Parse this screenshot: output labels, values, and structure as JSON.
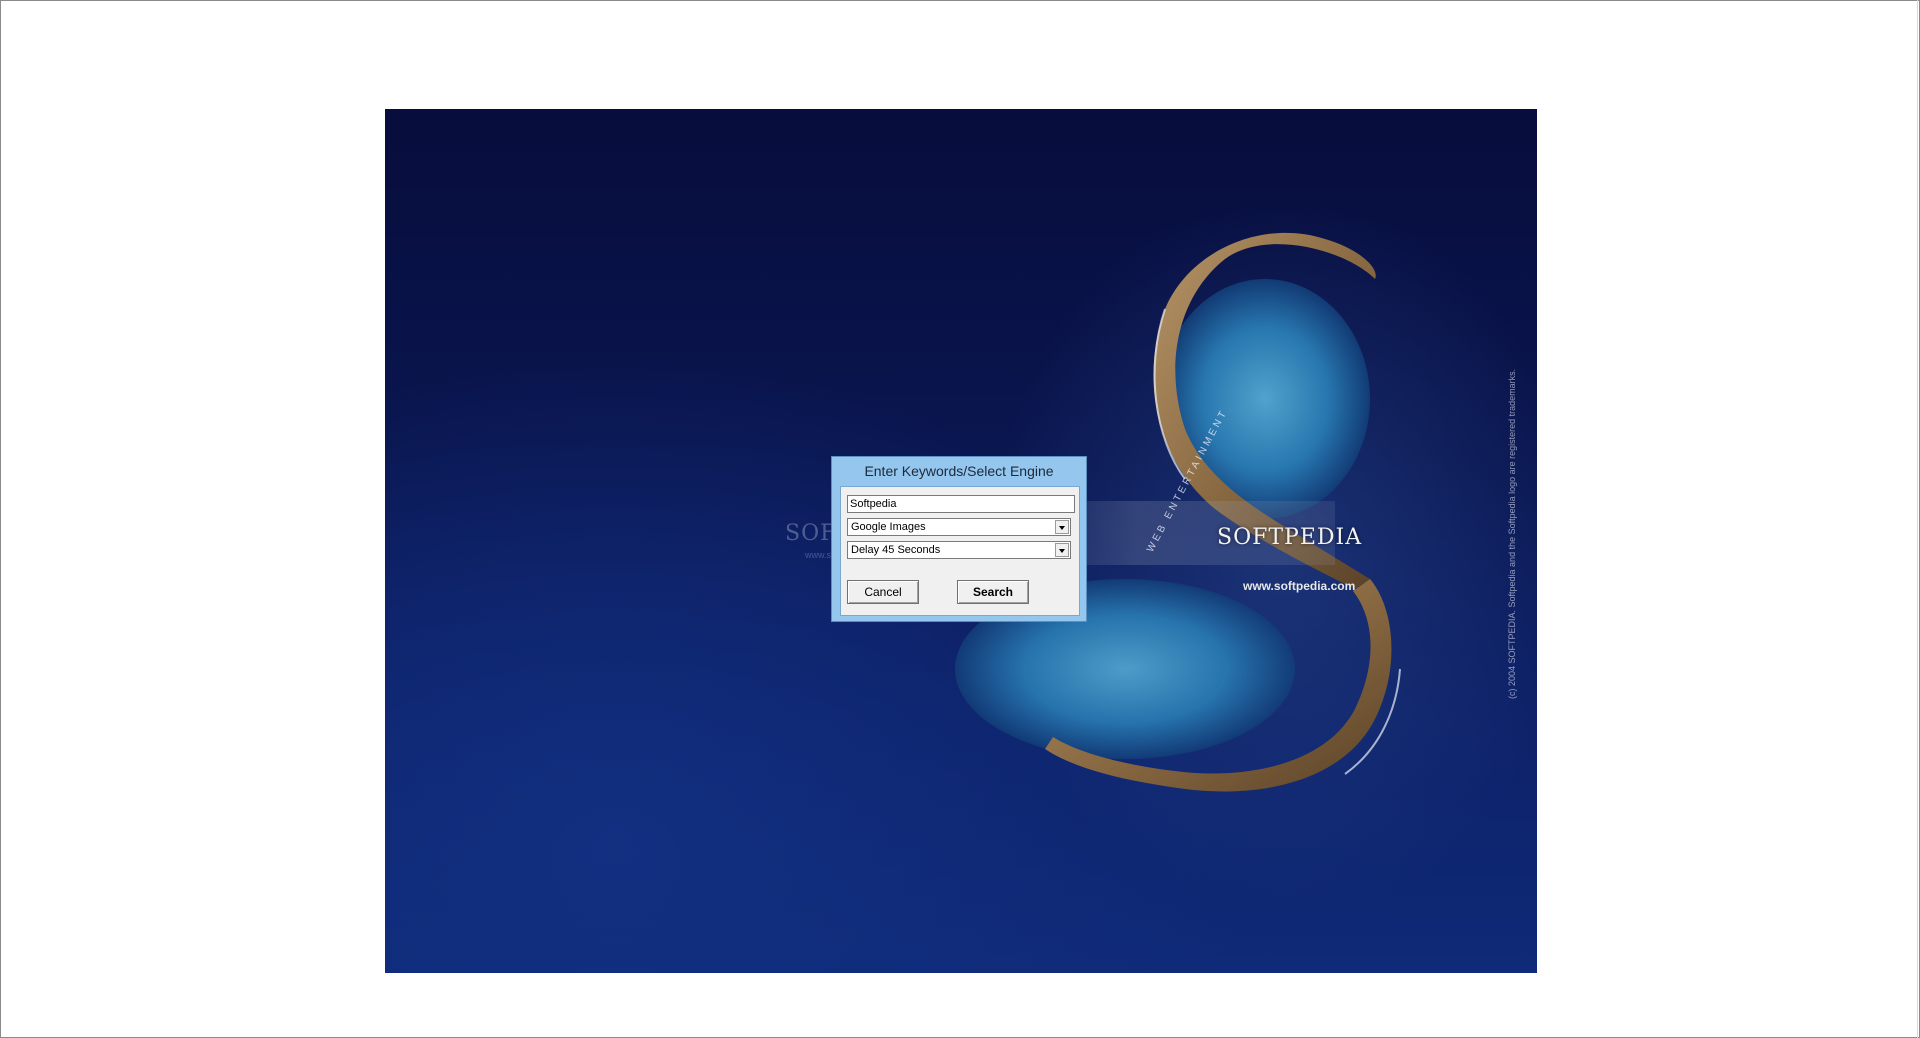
{
  "wallpaper": {
    "brand": "SOFTPEDIA",
    "url": "www.softpedia.com",
    "tagline": "WEB ENTERTAINMENT",
    "copyright": "(c) 2004 SOFTPEDIA. Softpedia and the Softpedia logo are registered trademarks.",
    "ghost_brand": "SOFT",
    "ghost_url": "www.so",
    "colors": {
      "deep": "#070d3c",
      "mid": "#0d2168",
      "land": "#8a6a42",
      "lagoon": "#2a80b8"
    }
  },
  "dialog": {
    "title": "Enter Keywords/Select Engine",
    "keyword_value": "Softpedia",
    "engine_selected": "Google Images",
    "delay_selected": "Delay 45 Seconds",
    "cancel_label": "Cancel",
    "search_label": "Search",
    "title_color": "#95c6ee"
  }
}
